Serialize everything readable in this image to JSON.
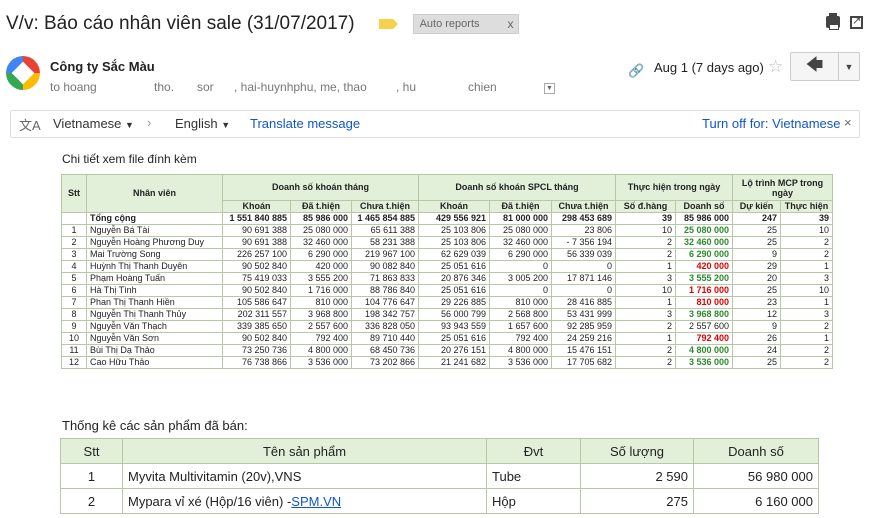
{
  "email": {
    "subject": "V/v: Báo cáo nhân viên sale (31/07/2017)",
    "label_chip": "Auto reports",
    "label_chip_close": "x",
    "sender": "Công ty Sắc Màu",
    "recipients": [
      "to hoang",
      "tho.",
      "sor",
      ", hai-huynhphu, me, thao",
      ", hu",
      "chien"
    ],
    "date": "Aug 1 (7 days ago)"
  },
  "translate_bar": {
    "from_lang": "Vietnamese",
    "to_lang": "English",
    "translate_link": "Translate message",
    "turn_off": "Turn off for: Vietnamese",
    "close": "×"
  },
  "body": {
    "intro": "Chi tiết xem file đính kèm",
    "products_title": "Thống kê các sản phẩm đã bán:"
  },
  "sales_table": {
    "group_headers": {
      "stt": "Stt",
      "nhanvien": "Nhân viên",
      "khoan": "Doanh số khoán tháng",
      "spcl": "Doanh số khoán SPCL tháng",
      "thuchien": "Thực hiện trong ngày",
      "lotrinh": "Lộ trình MCP trong ngày"
    },
    "sub_headers": [
      "Khoán",
      "Đã t.hiện",
      "Chưa t.hiện",
      "Khoán",
      "Đã t.hiện",
      "Chưa t.hiện",
      "Số đ.hàng",
      "Doanh số",
      "Dự kiến",
      "Thực hiện"
    ],
    "total_row": [
      "",
      "Tổng cộng",
      "1 551 840 885",
      "85 986 000",
      "1 465 854 885",
      "429 556 921",
      "81 000 000",
      "298 453 689",
      "39",
      "85 986 000",
      "247",
      "39"
    ],
    "rows": [
      [
        "1",
        "Nguyễn Bá Tài",
        "90 691 388",
        "25 080 000",
        "65 611 388",
        "25 103 806",
        "25 080 000",
        "23 806",
        "10",
        "25 080 000",
        "25",
        "10"
      ],
      [
        "2",
        "Nguyễn Hoàng Phương Duy",
        "90 691 388",
        "32 460 000",
        "58 231 388",
        "25 103 806",
        "32 460 000",
        "- 7 356 194",
        "2",
        "32 460 000",
        "25",
        "2"
      ],
      [
        "3",
        "Mai Trường Song",
        "226 257 100",
        "6 290 000",
        "219 967 100",
        "62 629 039",
        "6 290 000",
        "56 339 039",
        "2",
        "6 290 000",
        "9",
        "2"
      ],
      [
        "4",
        "Huỳnh Thị Thanh Duyên",
        "90 502 840",
        "420 000",
        "90 082 840",
        "25 051 616",
        "0",
        "0",
        "1",
        "420 000",
        "29",
        "1"
      ],
      [
        "5",
        "Phạm Hoàng Tuấn",
        "75 419 033",
        "3 555 200",
        "71 863 833",
        "20 876 346",
        "3 005 200",
        "17 871 146",
        "3",
        "3 555 200",
        "20",
        "3"
      ],
      [
        "6",
        "Hà Thị Tình",
        "90 502 840",
        "1 716 000",
        "88 786 840",
        "25 051 616",
        "0",
        "0",
        "10",
        "1 716 000",
        "25",
        "10"
      ],
      [
        "7",
        "Phan Thị Thanh Hiền",
        "105 586 647",
        "810 000",
        "104 776 647",
        "29 226 885",
        "810 000",
        "28 416 885",
        "1",
        "810 000",
        "23",
        "1"
      ],
      [
        "8",
        "Nguyễn Thị Thanh Thủy",
        "202 311 557",
        "3 968 800",
        "198 342 757",
        "56 000 799",
        "2 568 800",
        "53 431 999",
        "3",
        "3 968 800",
        "12",
        "3"
      ],
      [
        "9",
        "Nguyễn Văn Thạch",
        "339 385 650",
        "2 557 600",
        "336 828 050",
        "93 943 559",
        "1 657 600",
        "92 285 959",
        "2",
        "2 557 600",
        "9",
        "2"
      ],
      [
        "10",
        "Nguyễn Văn Sơn",
        "90 502 840",
        "792 400",
        "89 710 440",
        "25 051 616",
        "792 400",
        "24 259 216",
        "1",
        "792 400",
        "26",
        "1"
      ],
      [
        "11",
        "Bùi Thị Dạ Thảo",
        "73 250 736",
        "4 800 000",
        "68 450 736",
        "20 276 151",
        "4 800 000",
        "15 476 151",
        "2",
        "4 800 000",
        "24",
        "2"
      ],
      [
        "12",
        "Cao Hữu Thảo",
        "76 738 866",
        "3 536 000",
        "73 202 866",
        "21 241 682",
        "3 536 000",
        "17 705 682",
        "2",
        "3 536 000",
        "25",
        "2"
      ]
    ],
    "doanhso_colors": [
      "green",
      "green",
      "green",
      "red",
      "green",
      "red",
      "red",
      "green",
      "none",
      "red",
      "green",
      "green"
    ]
  },
  "products_table": {
    "headers": [
      "Stt",
      "Tên sản phẩm",
      "Đvt",
      "Số lượng",
      "Doanh số"
    ],
    "rows": [
      {
        "stt": "1",
        "name": "Myvita Multivitamin (20v),VNS",
        "link": "",
        "unit": "Tube",
        "qty": "2 590",
        "revenue": "56 980 000"
      },
      {
        "stt": "2",
        "name": "Mypara vỉ xé (Hộp/16 viên) -",
        "link": "SPM.VN",
        "unit": "Hộp",
        "qty": "275",
        "revenue": "6 160 000"
      }
    ]
  },
  "colors": {
    "header_bg": "#e2f0d9",
    "link": "#1155cc",
    "green": "#2a8a2a",
    "red": "#e00000"
  }
}
